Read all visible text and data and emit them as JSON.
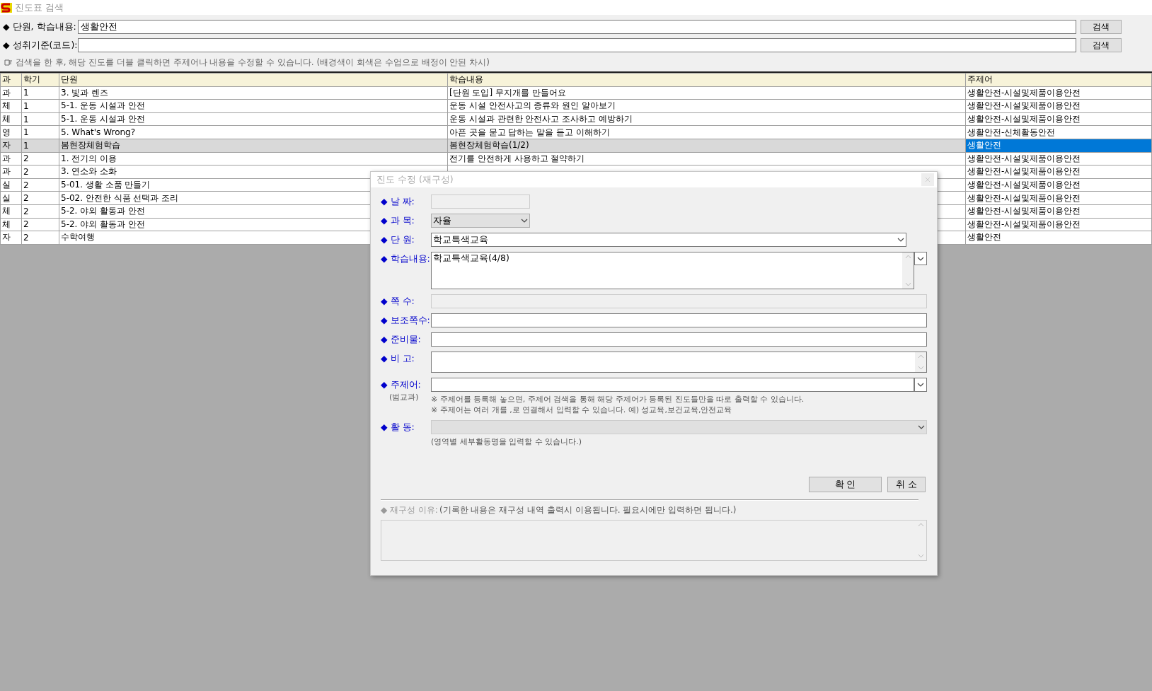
{
  "window": {
    "title": "진도표 검색"
  },
  "search": {
    "rows": [
      {
        "label": "◆ 단원, 학습내용:",
        "value": "생활안전",
        "button": "검색"
      },
      {
        "label": "◆ 성취기준(코드):",
        "button": "검색"
      }
    ],
    "hint": "검색을 한 후,  해당 진도를 더블 클릭하면 주제어나 내용을 수정할 수 있습니다. (배경색이 회색은 수업으로 배정이 안된 차시)"
  },
  "table": {
    "columns": [
      "과",
      "학기",
      "단원",
      "학습내용",
      "주제어"
    ],
    "rows": [
      {
        "subject": "과",
        "term": "1",
        "unit": "3. 빛과 렌즈",
        "content": "[단원 도입] 무지개를 만들어요",
        "theme": "생활안전-시설및제품이용안전",
        "unassigned": false,
        "selected": false
      },
      {
        "subject": "체",
        "term": "1",
        "unit": "5-1. 운동 시설과 안전",
        "content": "운동 시설 안전사고의 종류와 원인 알아보기",
        "theme": "생활안전-시설및제품이용안전",
        "unassigned": false,
        "selected": false
      },
      {
        "subject": "체",
        "term": "1",
        "unit": "5-1. 운동 시설과 안전",
        "content": "운동 시설과 관련한 안전사고 조사하고 예방하기",
        "theme": "생활안전-시설및제품이용안전",
        "unassigned": false,
        "selected": false
      },
      {
        "subject": "영",
        "term": "1",
        "unit": "5. What's Wrong?",
        "content": "아픈 곳을 묻고 답하는 말을 듣고 이해하기",
        "theme": "생활안전-신체활동안전",
        "unassigned": false,
        "selected": false
      },
      {
        "subject": "자",
        "term": "1",
        "unit": "봄현장체험학습",
        "content": "봄현장체험학습(1/2)",
        "theme": "생활안전",
        "unassigned": true,
        "selected": true
      },
      {
        "subject": "과",
        "term": "2",
        "unit": "1. 전기의 이용",
        "content": "전기를 안전하게 사용하고 절약하기",
        "theme": "생활안전-시설및제품이용안전",
        "unassigned": false,
        "selected": false
      },
      {
        "subject": "과",
        "term": "2",
        "unit": "3. 연소와 소화",
        "theme": "생활안전-시설및제품이용안전",
        "unassigned": false,
        "selected": false
      },
      {
        "subject": "실",
        "term": "2",
        "unit": "5-01. 생활 소품 만들기",
        "theme": "생활안전-시설및제품이용안전",
        "unassigned": false,
        "selected": false
      },
      {
        "subject": "실",
        "term": "2",
        "unit": "5-02. 안전한 식품 선택과 조리",
        "theme": "생활안전-시설및제품이용안전",
        "unassigned": false,
        "selected": false
      },
      {
        "subject": "체",
        "term": "2",
        "unit": "5-2. 야외 활동과 안전",
        "theme": "생활안전-시설및제품이용안전",
        "unassigned": false,
        "selected": false
      },
      {
        "subject": "체",
        "term": "2",
        "unit": "5-2. 야외 활동과 안전",
        "theme": "생활안전-시설및제품이용안전",
        "unassigned": false,
        "selected": false
      },
      {
        "subject": "자",
        "term": "2",
        "unit": "수학여행",
        "theme": "생활안전",
        "unassigned": false,
        "selected": false
      }
    ]
  },
  "dialog": {
    "title": "진도 수정 (재구성)",
    "fields": [
      {
        "label": "◆ 날 짜:",
        "kind": "short_text",
        "disabled": true
      },
      {
        "label": "◆ 과 목:",
        "kind": "select",
        "value": "자율",
        "disabled": false
      },
      {
        "label": "◆ 단 원:",
        "kind": "combo",
        "value": "학교특색교육",
        "disabled": false
      },
      {
        "label": "◆ 학습내용:",
        "kind": "textarea_list",
        "value": "학교특색교육(4/8)",
        "disabled": false
      },
      {
        "label": "◆ 쪽 수:",
        "kind": "text",
        "disabled": true
      },
      {
        "label": "◆ 보조쪽수:",
        "kind": "text",
        "disabled": false
      },
      {
        "label": "◆ 준비물:",
        "kind": "text",
        "disabled": false
      },
      {
        "label": "◆ 비 고:",
        "kind": "textarea",
        "disabled": false
      },
      {
        "label": "◆ 주제어:",
        "sublabel": "(범교과)",
        "kind": "combo_button",
        "disabled": false,
        "notes": [
          "※ 주제어를 등록해 놓으면, 주제어 검색을 통해 해당 주제어가 등록된 진도들만을 따로 출력할 수 있습니다.",
          "※ 주제어는 여러 개를 ,로 연결해서 입력할 수 있습니다.  예) 성교육,보건교육,안전교육"
        ]
      },
      {
        "label": "◆ 활 동:",
        "kind": "combo",
        "disabled": true,
        "notes": [
          "(영역별 세부활동명을 입력할 수 있습니다.)"
        ]
      }
    ],
    "buttons": [
      "확 인",
      "취 소"
    ],
    "reason": {
      "label": "◆ 재구성 이유:",
      "note": "(기록한 내용은 재구성 내역 출력시 이용됩니다. 필요시에만 입력하면 됩니다.)",
      "disabled": true
    }
  }
}
